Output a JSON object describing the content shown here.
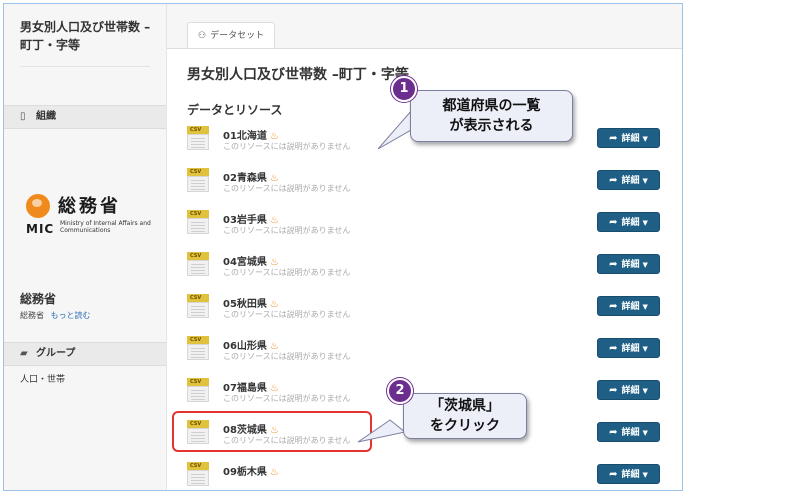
{
  "sidebar": {
    "dataset_title": "男女別人口及び世帯数 –町丁・字等",
    "org_section_label": "組織",
    "org_logo_kanji": "総務省",
    "org_logo_abbr": "MIC",
    "org_logo_english": "Ministry of Internal Affairs and Communications",
    "org_name": "総務省",
    "org_description": "総務省",
    "read_more": "もっと読む",
    "group_section_label": "グループ",
    "group_item": "人口・世帯"
  },
  "main": {
    "tab_label": "データセット",
    "page_title": "男女別人口及び世帯数 –町丁・字等",
    "section_title": "データとリソース",
    "resources": [
      {
        "name": "01北海道",
        "format": "CSV",
        "description": "このリソースには説明がありません",
        "button": "詳細"
      },
      {
        "name": "02青森県",
        "format": "CSV",
        "description": "このリソースには説明がありません",
        "button": "詳細"
      },
      {
        "name": "03岩手県",
        "format": "CSV",
        "description": "このリソースには説明がありません",
        "button": "詳細"
      },
      {
        "name": "04宮城県",
        "format": "CSV",
        "description": "このリソースには説明がありません",
        "button": "詳細"
      },
      {
        "name": "05秋田県",
        "format": "CSV",
        "description": "このリソースには説明がありません",
        "button": "詳細"
      },
      {
        "name": "06山形県",
        "format": "CSV",
        "description": "このリソースには説明がありません",
        "button": "詳細"
      },
      {
        "name": "07福島県",
        "format": "CSV",
        "description": "このリソースには説明がありません",
        "button": "詳細"
      },
      {
        "name": "08茨城県",
        "format": "CSV",
        "description": "このリソースには説明がありません",
        "button": "詳細"
      },
      {
        "name": "09栃木県",
        "format": "CSV",
        "description": "",
        "button": "詳細"
      }
    ]
  },
  "annotations": {
    "callout1": {
      "number": "1",
      "line1": "都道府県の一覧",
      "line2": "が表示される"
    },
    "callout2": {
      "number": "2",
      "line1": "「茨城県」",
      "line2": "をクリック"
    },
    "color_badge": "#6b2d8e",
    "color_highlight": "#e53232"
  },
  "colors": {
    "button": "#1f5f86",
    "csv_icon": "#e2c23d",
    "link": "#2a6cb5"
  }
}
